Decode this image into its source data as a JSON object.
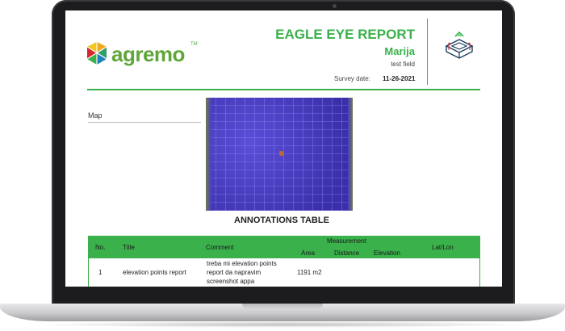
{
  "header": {
    "logo_text": "agremo",
    "logo_tm": "TM",
    "report_title": "EAGLE EYE REPORT",
    "user_name": "Marija",
    "field_name": "test field",
    "survey_label": "Survey date:",
    "survey_date": "11-26-2021"
  },
  "map": {
    "label": "Map"
  },
  "annotations": {
    "title": "ANNOTATIONS TABLE",
    "columns": {
      "no": "No.",
      "title": "Title",
      "comment": "Comment",
      "measurement": "Measurement",
      "area": "Area",
      "distance": "Distance",
      "elevation": "Elevation",
      "latlon": "Lat/Lon"
    },
    "rows": [
      {
        "no": "1",
        "title": "elevation points report",
        "comment_line1": "treba mi elevation points",
        "comment_line2": "report da napravim",
        "comment_line3": "screenshot appa",
        "area": "1191 m2",
        "distance": "",
        "elevation": "",
        "latlon": ""
      }
    ]
  },
  "colors": {
    "accent_green": "#3ab14b",
    "logo_green": "#5fa63a",
    "map_purple": "#4a3ec2"
  }
}
